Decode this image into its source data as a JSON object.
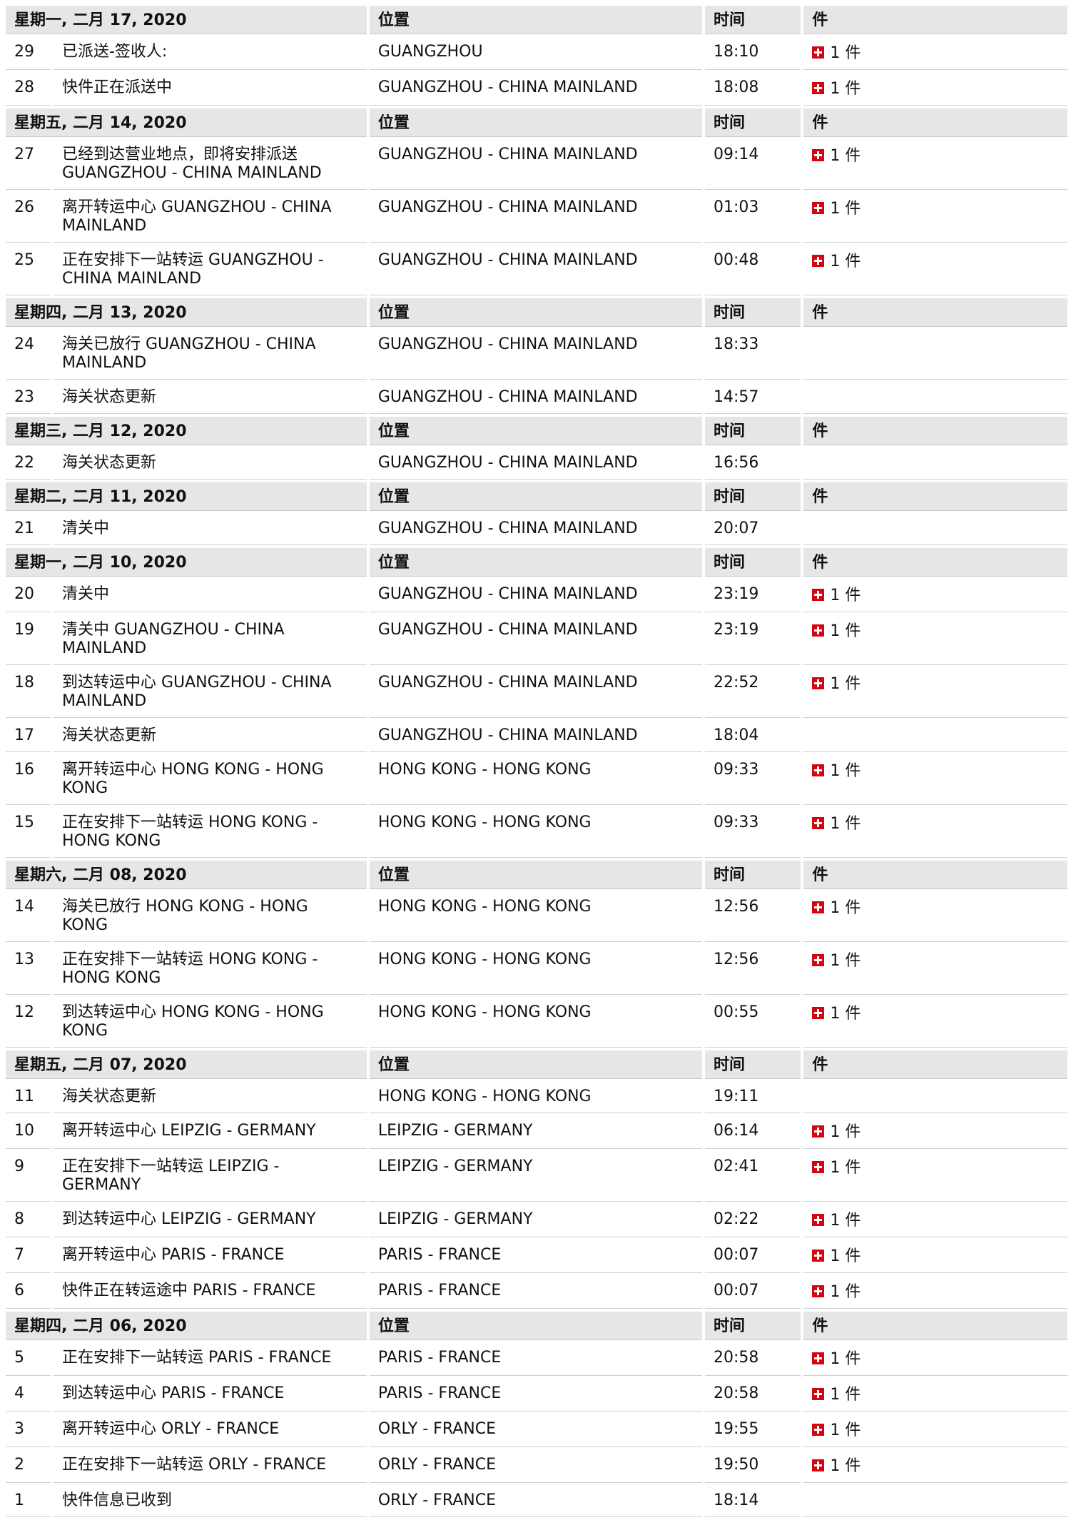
{
  "headers": {
    "location": "位置",
    "time": "时间",
    "pieces": "件"
  },
  "icons": {
    "piece": "red-cross-icon"
  },
  "colors": {
    "header_bg": "#e6e6e6",
    "icon_red": "#d40511"
  },
  "groups": [
    {
      "date": "星期一, 二月 17, 2020",
      "events": [
        {
          "n": "29",
          "desc": "已派送-签收人:",
          "loc": "GUANGZHOU",
          "time": "18:10",
          "pieces": "1 件"
        },
        {
          "n": "28",
          "desc": "快件正在派送中",
          "loc": "GUANGZHOU - CHINA MAINLAND",
          "time": "18:08",
          "pieces": "1 件"
        }
      ]
    },
    {
      "date": "星期五, 二月 14, 2020",
      "events": [
        {
          "n": "27",
          "desc": "已经到达营业地点，即将安排派送 GUANGZHOU - CHINA MAINLAND",
          "loc": "GUANGZHOU - CHINA MAINLAND",
          "time": "09:14",
          "pieces": "1 件"
        },
        {
          "n": "26",
          "desc": "离开转运中心 GUANGZHOU - CHINA MAINLAND",
          "loc": "GUANGZHOU - CHINA MAINLAND",
          "time": "01:03",
          "pieces": "1 件"
        },
        {
          "n": "25",
          "desc": "正在安排下一站转运 GUANGZHOU - CHINA MAINLAND",
          "loc": "GUANGZHOU - CHINA MAINLAND",
          "time": "00:48",
          "pieces": "1 件"
        }
      ]
    },
    {
      "date": "星期四, 二月 13, 2020",
      "events": [
        {
          "n": "24",
          "desc": "海关已放行 GUANGZHOU - CHINA MAINLAND",
          "loc": "GUANGZHOU - CHINA MAINLAND",
          "time": "18:33",
          "pieces": ""
        },
        {
          "n": "23",
          "desc": "海关状态更新",
          "loc": "GUANGZHOU - CHINA MAINLAND",
          "time": "14:57",
          "pieces": ""
        }
      ]
    },
    {
      "date": "星期三, 二月 12, 2020",
      "events": [
        {
          "n": "22",
          "desc": "海关状态更新",
          "loc": "GUANGZHOU - CHINA MAINLAND",
          "time": "16:56",
          "pieces": ""
        }
      ]
    },
    {
      "date": "星期二, 二月 11, 2020",
      "events": [
        {
          "n": "21",
          "desc": "清关中",
          "loc": "GUANGZHOU - CHINA MAINLAND",
          "time": "20:07",
          "pieces": ""
        }
      ]
    },
    {
      "date": "星期一, 二月 10, 2020",
      "events": [
        {
          "n": "20",
          "desc": "清关中",
          "loc": "GUANGZHOU - CHINA MAINLAND",
          "time": "23:19",
          "pieces": "1 件"
        },
        {
          "n": "19",
          "desc": "清关中 GUANGZHOU - CHINA MAINLAND",
          "loc": "GUANGZHOU - CHINA MAINLAND",
          "time": "23:19",
          "pieces": "1 件"
        },
        {
          "n": "18",
          "desc": "到达转运中心 GUANGZHOU - CHINA MAINLAND",
          "loc": "GUANGZHOU - CHINA MAINLAND",
          "time": "22:52",
          "pieces": "1 件"
        },
        {
          "n": "17",
          "desc": "海关状态更新",
          "loc": "GUANGZHOU - CHINA MAINLAND",
          "time": "18:04",
          "pieces": ""
        },
        {
          "n": "16",
          "desc": "离开转运中心 HONG KONG - HONG KONG",
          "loc": "HONG KONG - HONG KONG",
          "time": "09:33",
          "pieces": "1 件"
        },
        {
          "n": "15",
          "desc": "正在安排下一站转运 HONG KONG - HONG KONG",
          "loc": "HONG KONG - HONG KONG",
          "time": "09:33",
          "pieces": "1 件"
        }
      ]
    },
    {
      "date": "星期六, 二月 08, 2020",
      "events": [
        {
          "n": "14",
          "desc": "海关已放行 HONG KONG - HONG KONG",
          "loc": "HONG KONG - HONG KONG",
          "time": "12:56",
          "pieces": "1 件"
        },
        {
          "n": "13",
          "desc": "正在安排下一站转运 HONG KONG - HONG KONG",
          "loc": "HONG KONG - HONG KONG",
          "time": "12:56",
          "pieces": "1 件"
        },
        {
          "n": "12",
          "desc": "到达转运中心 HONG KONG - HONG KONG",
          "loc": "HONG KONG - HONG KONG",
          "time": "00:55",
          "pieces": "1 件"
        }
      ]
    },
    {
      "date": "星期五, 二月 07, 2020",
      "events": [
        {
          "n": "11",
          "desc": "海关状态更新",
          "loc": "HONG KONG - HONG KONG",
          "time": "19:11",
          "pieces": ""
        },
        {
          "n": "10",
          "desc": "离开转运中心 LEIPZIG - GERMANY",
          "loc": "LEIPZIG - GERMANY",
          "time": "06:14",
          "pieces": "1 件"
        },
        {
          "n": "9",
          "desc": "正在安排下一站转运 LEIPZIG - GERMANY",
          "loc": "LEIPZIG - GERMANY",
          "time": "02:41",
          "pieces": "1 件"
        },
        {
          "n": "8",
          "desc": "到达转运中心 LEIPZIG - GERMANY",
          "loc": "LEIPZIG - GERMANY",
          "time": "02:22",
          "pieces": "1 件"
        },
        {
          "n": "7",
          "desc": "离开转运中心 PARIS - FRANCE",
          "loc": "PARIS - FRANCE",
          "time": "00:07",
          "pieces": "1 件"
        },
        {
          "n": "6",
          "desc": "快件正在转运途中 PARIS - FRANCE",
          "loc": "PARIS - FRANCE",
          "time": "00:07",
          "pieces": "1 件"
        }
      ]
    },
    {
      "date": "星期四, 二月 06, 2020",
      "events": [
        {
          "n": "5",
          "desc": "正在安排下一站转运 PARIS - FRANCE",
          "loc": "PARIS - FRANCE",
          "time": "20:58",
          "pieces": "1 件"
        },
        {
          "n": "4",
          "desc": "到达转运中心 PARIS - FRANCE",
          "loc": "PARIS - FRANCE",
          "time": "20:58",
          "pieces": "1 件"
        },
        {
          "n": "3",
          "desc": "离开转运中心 ORLY - FRANCE",
          "loc": "ORLY - FRANCE",
          "time": "19:55",
          "pieces": "1 件"
        },
        {
          "n": "2",
          "desc": "正在安排下一站转运 ORLY - FRANCE",
          "loc": "ORLY - FRANCE",
          "time": "19:50",
          "pieces": "1 件"
        },
        {
          "n": "1",
          "desc": "快件信息已收到",
          "loc": "ORLY - FRANCE",
          "time": "18:14",
          "pieces": ""
        }
      ]
    }
  ]
}
